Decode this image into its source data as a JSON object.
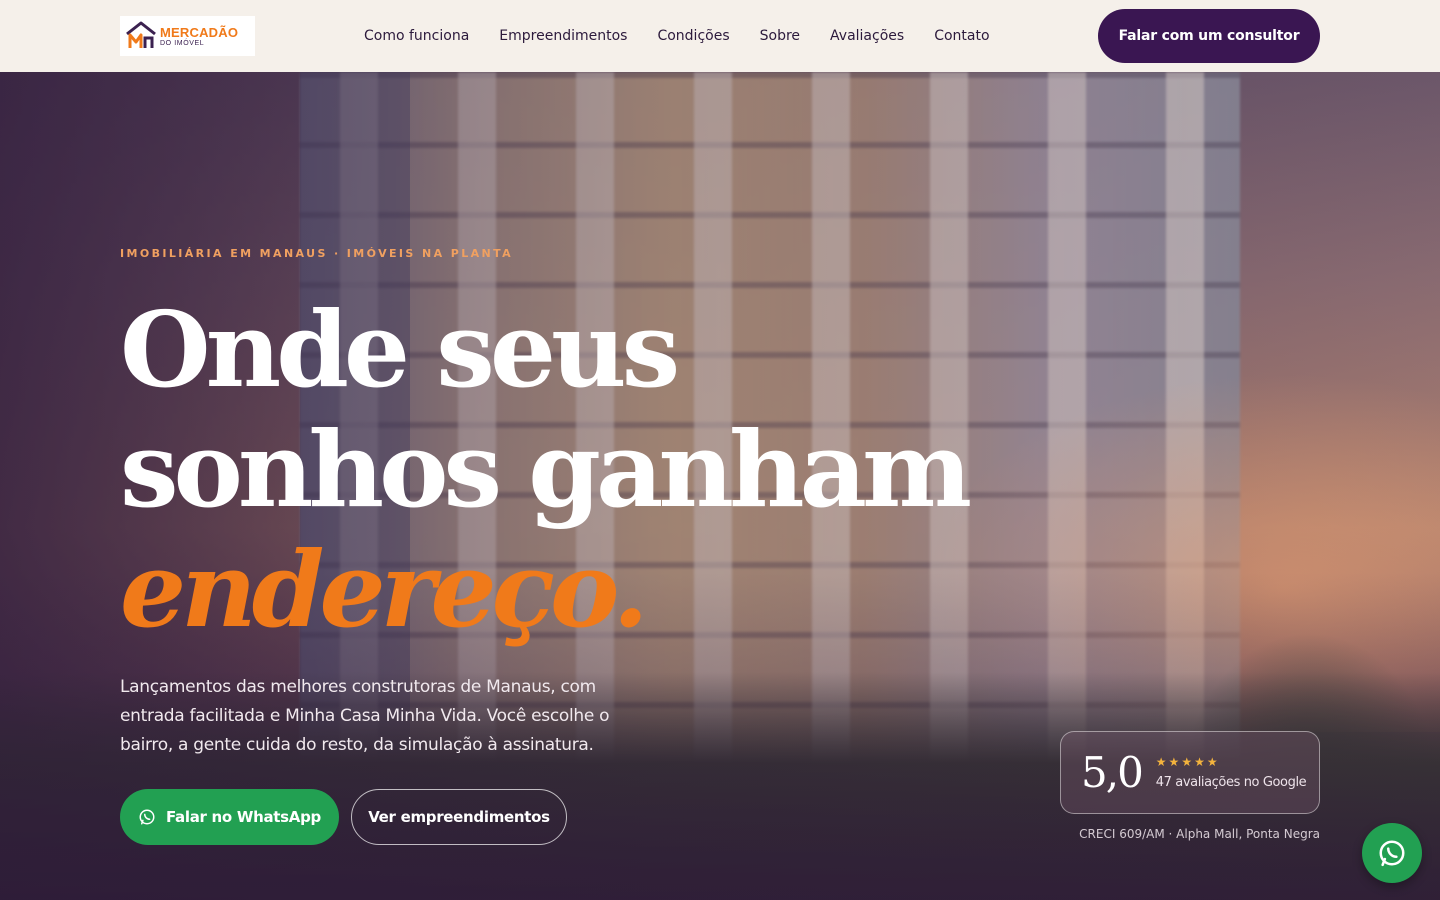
{
  "brand": {
    "logo_main": "MERCADÃO",
    "logo_sub": "DO IMÓVEL",
    "accent": "#f07a1a",
    "primary": "#3a1652",
    "whatsapp": "#22a052"
  },
  "nav": {
    "items": [
      {
        "label": "Como funciona"
      },
      {
        "label": "Empreendimentos"
      },
      {
        "label": "Condições"
      },
      {
        "label": "Sobre"
      },
      {
        "label": "Avaliações"
      },
      {
        "label": "Contato"
      }
    ],
    "cta_label": "Falar com um consultor"
  },
  "hero": {
    "eyebrow": "IMOBILIÁRIA EM MANAUS · IMÓVEIS NA PLANTA",
    "title_line1": "Onde seus",
    "title_line2": "sonhos ganham",
    "title_accent": "endereço.",
    "lead": "Lançamentos das melhores construtoras de Manaus, com entrada facilitada e Minha Casa Minha Vida. Você escolhe o bairro, a gente cuida do resto, da simulação à assinatura.",
    "whatsapp_button": "Falar no WhatsApp",
    "secondary_button": "Ver empreendimentos"
  },
  "rating": {
    "score": "5,0",
    "stars": "★★★★★",
    "label": "47 avaliações no Google"
  },
  "creci": "CRECI 609/AM · Alpha Mall, Ponta Negra",
  "icons": {
    "logo": "house-m-logo",
    "whatsapp": "whatsapp-icon"
  }
}
